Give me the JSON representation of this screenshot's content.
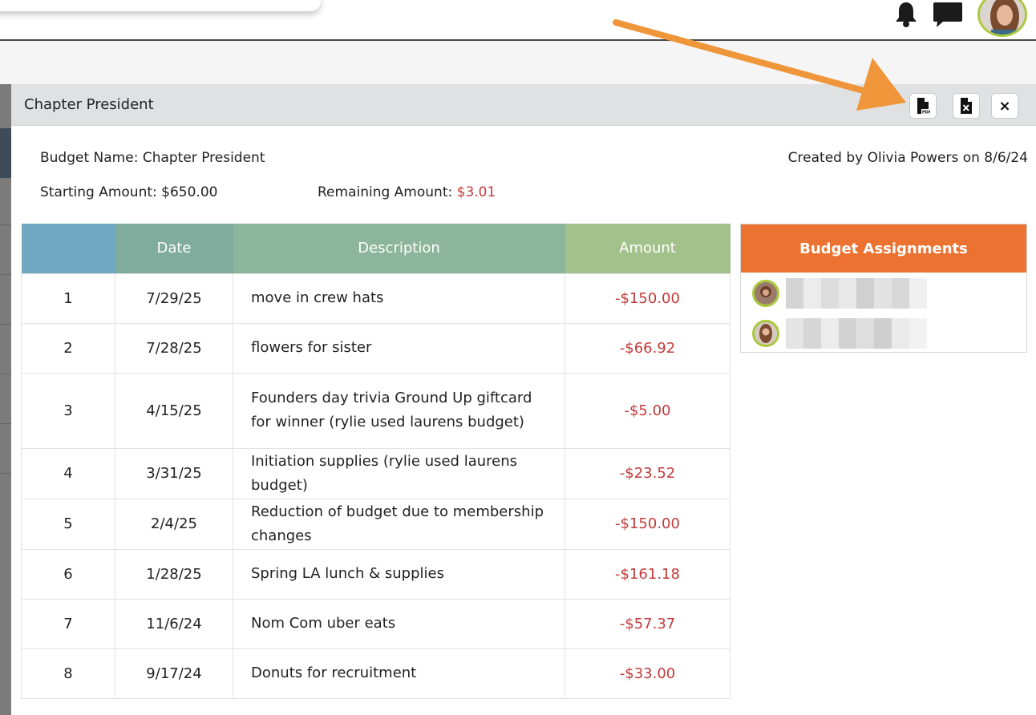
{
  "header": {
    "icons": [
      "bell-icon",
      "chat-icon",
      "user-avatar"
    ]
  },
  "modal": {
    "title": "Chapter President",
    "buttons": {
      "pdf_icon": "pdf-file-icon",
      "excel_icon": "excel-file-icon",
      "close_label": "×"
    },
    "budget_name": "Budget Name: Chapter President",
    "created_by": "Created by Olivia Powers on 8/6/24",
    "starting_amount": "Starting Amount: $650.00",
    "remaining_label": "Remaining Amount: ",
    "remaining_value": "$3.01"
  },
  "table": {
    "headers": [
      "",
      "Date",
      "Description",
      "Amount"
    ],
    "rows": [
      {
        "num": "1",
        "date": "7/29/25",
        "desc": "move in crew hats",
        "amount": "-$150.00"
      },
      {
        "num": "2",
        "date": "7/28/25",
        "desc": "flowers for sister",
        "amount": "-$66.92"
      },
      {
        "num": "3",
        "date": "4/15/25",
        "desc": "Founders day trivia Ground Up giftcard for winner (rylie used laurens budget)",
        "amount": "-$5.00"
      },
      {
        "num": "4",
        "date": "3/31/25",
        "desc": "Initiation supplies (rylie used laurens budget)",
        "amount": "-$23.52"
      },
      {
        "num": "5",
        "date": "2/4/25",
        "desc": "Reduction of budget due to membership changes",
        "amount": "-$150.00"
      },
      {
        "num": "6",
        "date": "1/28/25",
        "desc": "Spring LA lunch & supplies",
        "amount": "-$161.18"
      },
      {
        "num": "7",
        "date": "11/6/24",
        "desc": "Nom Com uber eats",
        "amount": "-$57.37"
      },
      {
        "num": "8",
        "date": "9/17/24",
        "desc": "Donuts for recruitment",
        "amount": "-$33.00"
      }
    ]
  },
  "assignments": {
    "title": "Budget Assignments"
  },
  "colors": {
    "negative": "#c23a3a",
    "assign_header": "#ec7232",
    "annotation_arrow": "#f0963a"
  }
}
